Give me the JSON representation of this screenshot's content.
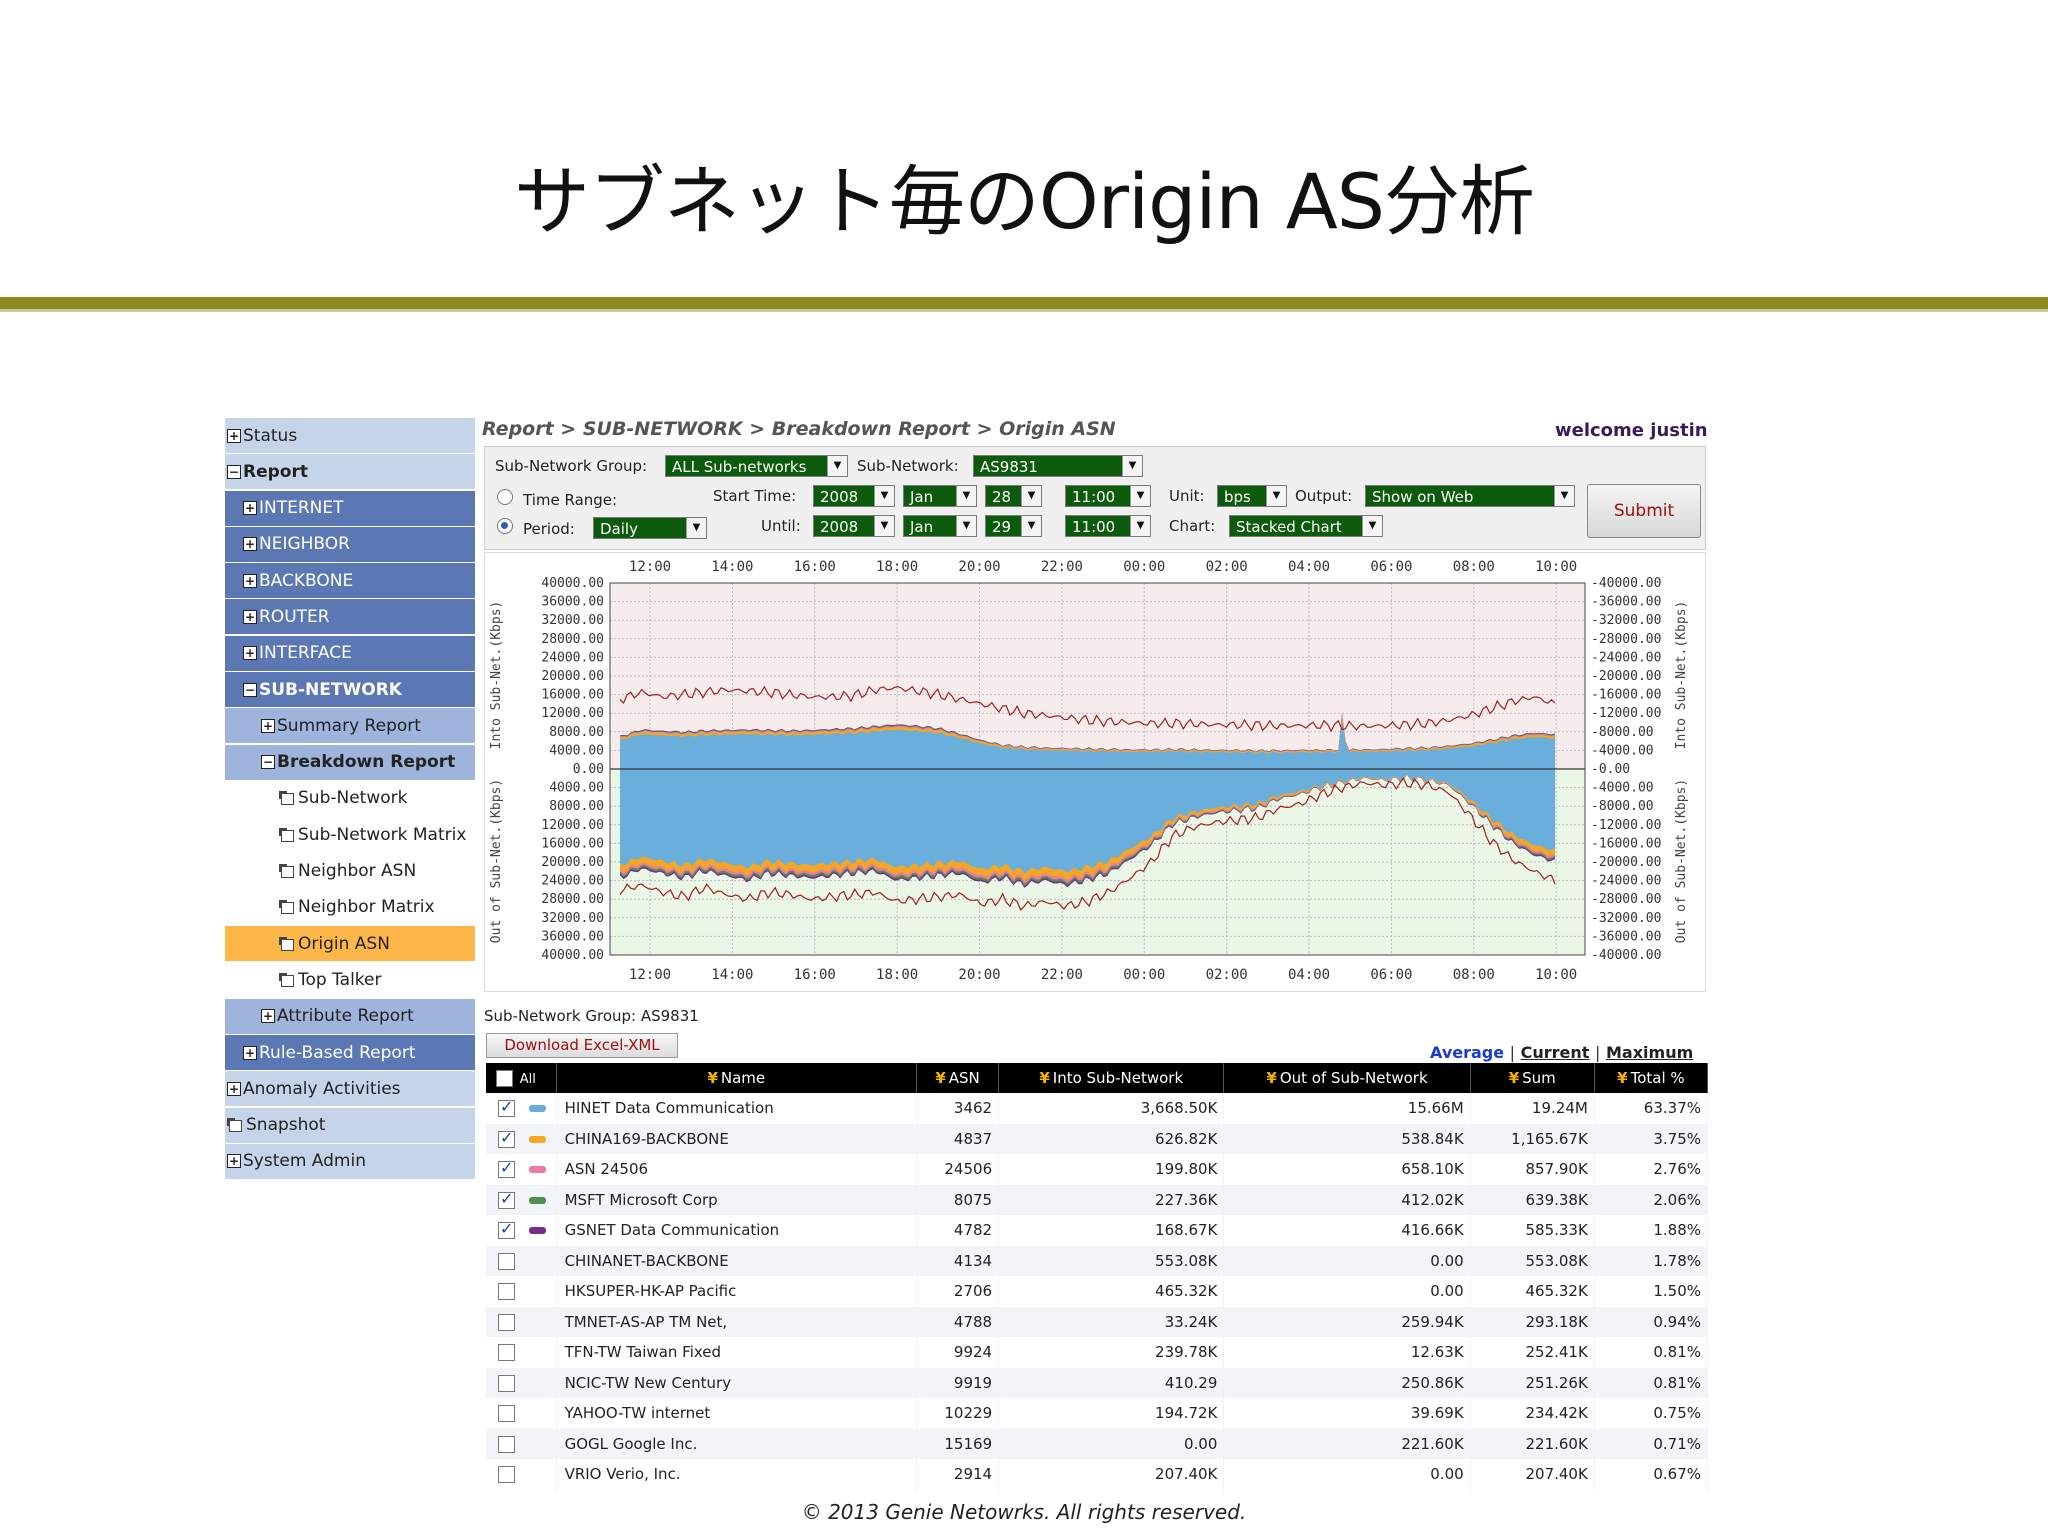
{
  "slide": {
    "title": "サブネット毎のOrigin AS分析",
    "footer": "© 2013 Genie Netowrks. All rights reserved."
  },
  "nav": {
    "items": [
      {
        "label": "Status",
        "level": 0,
        "icon": "expand-icon"
      },
      {
        "label": "Report",
        "level": 0,
        "icon": "collapse-icon",
        "bold": true
      },
      {
        "label": "INTERNET",
        "level": 1,
        "icon": "expand-icon"
      },
      {
        "label": "NEIGHBOR",
        "level": 1,
        "icon": "expand-icon"
      },
      {
        "label": "BACKBONE",
        "level": 1,
        "icon": "expand-icon"
      },
      {
        "label": "ROUTER",
        "level": 1,
        "icon": "expand-icon"
      },
      {
        "label": "INTERFACE",
        "level": 1,
        "icon": "expand-icon"
      },
      {
        "label": "SUB-NETWORK",
        "level": 1,
        "icon": "collapse-icon",
        "bold": true
      },
      {
        "label": "Summary Report",
        "level": 2,
        "icon": "expand-icon"
      },
      {
        "label": "Breakdown Report",
        "level": 2,
        "icon": "collapse-icon",
        "bold": true
      },
      {
        "label": "Sub-Network",
        "level": 3,
        "icon": "report-icon"
      },
      {
        "label": "Sub-Network Matrix",
        "level": 3,
        "icon": "report-icon"
      },
      {
        "label": "Neighbor ASN",
        "level": 3,
        "icon": "report-icon"
      },
      {
        "label": "Neighbor Matrix",
        "level": 3,
        "icon": "report-icon"
      },
      {
        "label": "Origin ASN",
        "level": 3,
        "icon": "report-icon",
        "active": true
      },
      {
        "label": "Top Talker",
        "level": 3,
        "icon": "report-icon"
      },
      {
        "label": "Attribute Report",
        "level": 2,
        "icon": "expand-icon"
      },
      {
        "label": "Rule-Based Report",
        "level": 1,
        "icon": "expand-icon"
      },
      {
        "label": "Anomaly Activities",
        "level": 0,
        "icon": "expand-icon"
      },
      {
        "label": "Snapshot",
        "level": 0,
        "icon": "report-icon"
      },
      {
        "label": "System Admin",
        "level": 0,
        "icon": "expand-icon"
      }
    ]
  },
  "header": {
    "breadcrumb": "Report > SUB-NETWORK > Breakdown Report > Origin ASN",
    "welcome": "welcome justin"
  },
  "form": {
    "subnet_group_label": "Sub-Network Group:",
    "subnet_group_value": "ALL Sub-networks",
    "subnet_label": "Sub-Network:",
    "subnet_value": "AS9831",
    "time_range_label": "Time Range:",
    "period_label": "Period:",
    "period_value": "Daily",
    "start_label": "Start Time:",
    "start_year": "2008",
    "start_month": "Jan",
    "start_day": "28",
    "start_time": "11:00",
    "until_label": "Until:",
    "until_year": "2008",
    "until_month": "Jan",
    "until_day": "29",
    "until_time": "11:00",
    "unit_label": "Unit:",
    "unit_value": "bps",
    "output_label": "Output:",
    "output_value": "Show on Web",
    "chart_label": "Chart:",
    "chart_value": "Stacked Chart",
    "submit_label": "Submit"
  },
  "chart_data": {
    "type": "area",
    "stacked": true,
    "x_ticks": [
      "12:00",
      "14:00",
      "16:00",
      "18:00",
      "20:00",
      "22:00",
      "00:00",
      "02:00",
      "04:00",
      "06:00",
      "08:00",
      "10:00"
    ],
    "y_ticks_top": [
      "40000.00",
      "36000.00",
      "32000.00",
      "28000.00",
      "24000.00",
      "20000.00",
      "16000.00",
      "12000.00",
      "8000.00",
      "4000.00",
      "0.00"
    ],
    "y_ticks_bottom": [
      "4000.00",
      "8000.00",
      "12000.00",
      "16000.00",
      "20000.00",
      "24000.00",
      "28000.00",
      "32000.00",
      "36000.00",
      "40000.00"
    ],
    "ylabel_top": "Into Sub-Net.(Kbps)",
    "ylabel_bottom": "Out of Sub-Net.(Kbps)",
    "ylim_top": [
      0,
      40000
    ],
    "ylim_bottom": [
      0,
      40000
    ],
    "grid": true,
    "colors": {
      "hinet": "#6aafdc",
      "china169": "#f5a623",
      "asn24506": "#ee7aa0",
      "msft": "#4f8f4f",
      "gsnet": "#7a2a8a",
      "total_line": "#a02020",
      "bg_top": "#f6ecec",
      "bg_bottom": "#eaf6e6"
    },
    "into_total_profile": [
      15000,
      16500,
      15500,
      16000,
      16500,
      17000,
      16800,
      16500,
      16000,
      15500,
      15500,
      15800,
      17000,
      17500,
      16800,
      16000,
      15000,
      14000,
      13000,
      12000,
      11500,
      11000,
      10500,
      10200,
      10000,
      9800,
      9800,
      9700,
      9500,
      9500,
      9400,
      9300,
      9300,
      9400,
      9300,
      9200,
      9300,
      9500,
      9800,
      10500,
      11500,
      13000,
      14500,
      15500,
      14000
    ],
    "into_stack_profile": [
      7000,
      8500,
      8200,
      8000,
      8300,
      8400,
      8500,
      8400,
      8300,
      8400,
      8600,
      8800,
      9200,
      9600,
      9300,
      8800,
      7600,
      6200,
      5200,
      4800,
      4600,
      4500,
      4400,
      4300,
      4200,
      4200,
      4300,
      4200,
      4100,
      4100,
      4000,
      4000,
      4100,
      4100,
      4200,
      4200,
      4300,
      4500,
      4600,
      5000,
      5500,
      6300,
      7200,
      7800,
      7500
    ],
    "out_stack_profile": [
      23500,
      21500,
      22500,
      23500,
      22000,
      23000,
      24000,
      22500,
      23000,
      23500,
      23000,
      22500,
      22000,
      24000,
      23500,
      23000,
      22500,
      24500,
      23500,
      25000,
      24000,
      25000,
      24000,
      22500,
      19500,
      16500,
      12000,
      10500,
      9500,
      9000,
      8500,
      6500,
      5500,
      4000,
      3000,
      2000,
      2500,
      2000,
      2500,
      3500,
      7500,
      12000,
      16000,
      18500,
      20000
    ],
    "out_total_profile": [
      26000,
      25000,
      26500,
      27500,
      25500,
      27000,
      28000,
      26500,
      27000,
      28000,
      27500,
      27000,
      26500,
      28500,
      28000,
      27500,
      27000,
      29000,
      28000,
      29500,
      28500,
      29500,
      28500,
      26500,
      23500,
      20000,
      14500,
      12500,
      11500,
      11000,
      10500,
      8500,
      7500,
      5500,
      4000,
      3000,
      3500,
      3000,
      3500,
      5000,
      10000,
      15500,
      19500,
      22000,
      24000
    ],
    "spike": {
      "x": "05:15",
      "value": 12000
    }
  },
  "table": {
    "group_label": "Sub-Network Group: AS9831",
    "download_label": "Download Excel-XML",
    "views": {
      "average": "Average",
      "current": "Current",
      "maximum": "Maximum",
      "sep": "|"
    },
    "headers": {
      "all": "All",
      "name": "Name",
      "asn": "ASN",
      "into": "Into Sub-Network",
      "out": "Out of Sub-Network",
      "sum": "Sum",
      "total": "Total %"
    },
    "rows": [
      {
        "checked": true,
        "color": "#6aafdc",
        "name": "HINET Data Communication",
        "asn": "3462",
        "into": "3,668.50K",
        "out": "15.66M",
        "sum": "19.24M",
        "total": "63.37%"
      },
      {
        "checked": true,
        "color": "#f5a623",
        "name": "CHINA169-BACKBONE",
        "asn": "4837",
        "into": "626.82K",
        "out": "538.84K",
        "sum": "1,165.67K",
        "total": "3.75%"
      },
      {
        "checked": true,
        "color": "#ee7aa0",
        "name": "ASN 24506",
        "asn": "24506",
        "into": "199.80K",
        "out": "658.10K",
        "sum": "857.90K",
        "total": "2.76%"
      },
      {
        "checked": true,
        "color": "#4f8f4f",
        "name": "MSFT Microsoft Corp",
        "asn": "8075",
        "into": "227.36K",
        "out": "412.02K",
        "sum": "639.38K",
        "total": "2.06%"
      },
      {
        "checked": true,
        "color": "#7a2a8a",
        "name": "GSNET Data Communication",
        "asn": "4782",
        "into": "168.67K",
        "out": "416.66K",
        "sum": "585.33K",
        "total": "1.88%"
      },
      {
        "checked": false,
        "color": "",
        "name": "CHINANET-BACKBONE",
        "asn": "4134",
        "into": "553.08K",
        "out": "0.00",
        "sum": "553.08K",
        "total": "1.78%"
      },
      {
        "checked": false,
        "color": "",
        "name": "HKSUPER-HK-AP Pacific",
        "asn": "2706",
        "into": "465.32K",
        "out": "0.00",
        "sum": "465.32K",
        "total": "1.50%"
      },
      {
        "checked": false,
        "color": "",
        "name": "TMNET-AS-AP TM Net,",
        "asn": "4788",
        "into": "33.24K",
        "out": "259.94K",
        "sum": "293.18K",
        "total": "0.94%"
      },
      {
        "checked": false,
        "color": "",
        "name": "TFN-TW Taiwan Fixed",
        "asn": "9924",
        "into": "239.78K",
        "out": "12.63K",
        "sum": "252.41K",
        "total": "0.81%"
      },
      {
        "checked": false,
        "color": "",
        "name": "NCIC-TW New Century",
        "asn": "9919",
        "into": "410.29",
        "out": "250.86K",
        "sum": "251.26K",
        "total": "0.81%"
      },
      {
        "checked": false,
        "color": "",
        "name": "YAHOO-TW internet",
        "asn": "10229",
        "into": "194.72K",
        "out": "39.69K",
        "sum": "234.42K",
        "total": "0.75%"
      },
      {
        "checked": false,
        "color": "",
        "name": "GOGL Google Inc.",
        "asn": "15169",
        "into": "0.00",
        "out": "221.60K",
        "sum": "221.60K",
        "total": "0.71%"
      },
      {
        "checked": false,
        "color": "",
        "name": "VRIO Verio, Inc.",
        "asn": "2914",
        "into": "207.40K",
        "out": "0.00",
        "sum": "207.40K",
        "total": "0.67%"
      }
    ]
  }
}
